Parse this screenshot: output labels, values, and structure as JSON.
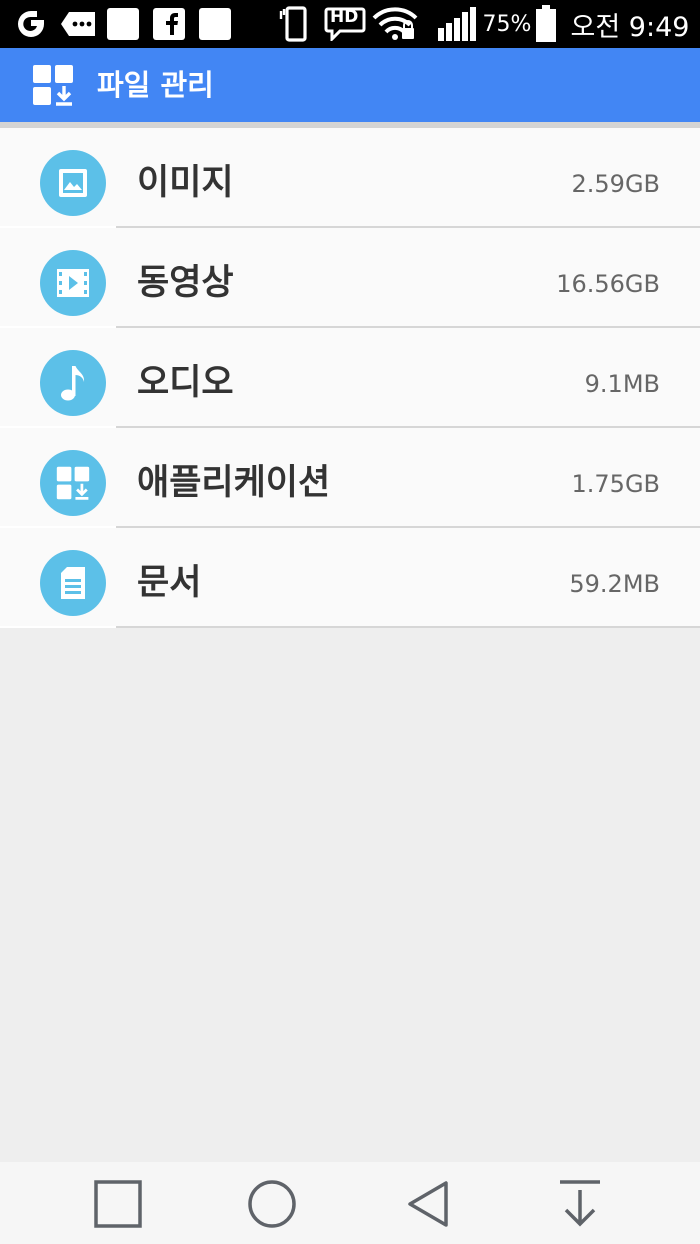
{
  "status_bar": {
    "battery_percent": "75%",
    "time": "오전 9:49",
    "hd_label": "HD",
    "icons": [
      "carrier-icon",
      "message-icon",
      "notification-icon",
      "facebook-icon",
      "notification-icon",
      "vibrate-icon",
      "hd-voice-icon",
      "wifi-icon",
      "signal-icon",
      "battery-icon"
    ]
  },
  "app_bar": {
    "title": "파일 관리",
    "icon": "file-manager-icon"
  },
  "categories": [
    {
      "label": "이미지",
      "size": "2.59GB",
      "icon": "image-icon"
    },
    {
      "label": "동영상",
      "size": "16.56GB",
      "icon": "video-icon"
    },
    {
      "label": "오디오",
      "size": "9.1MB",
      "icon": "audio-icon"
    },
    {
      "label": "애플리케이션",
      "size": "1.75GB",
      "icon": "application-icon"
    },
    {
      "label": "문서",
      "size": "59.2MB",
      "icon": "document-icon"
    }
  ],
  "nav_bar": {
    "buttons": [
      "recents-button",
      "home-button",
      "back-button",
      "notification-pull-button"
    ]
  },
  "colors": {
    "app_bar": "#4286f4",
    "icon_circle": "#5cc0e8",
    "background": "#eeeeee"
  }
}
